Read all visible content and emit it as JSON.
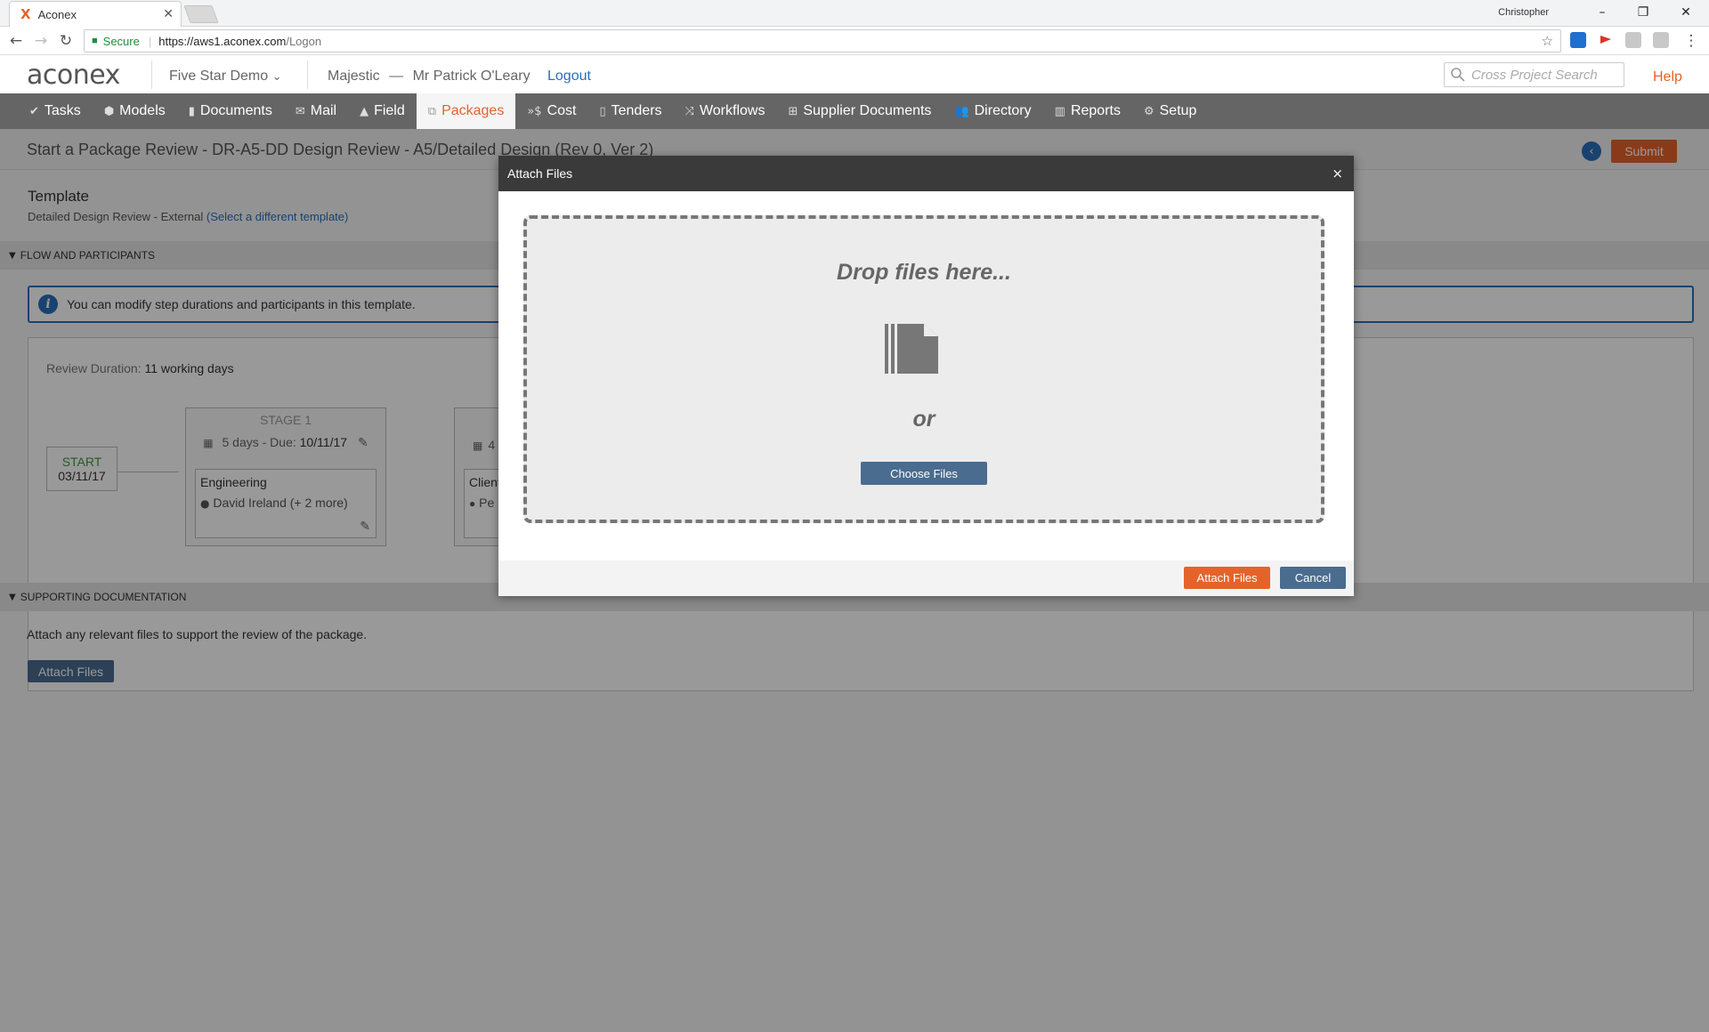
{
  "browser": {
    "tab_title": "Aconex",
    "tab_favicon": "X",
    "user": "Christopher",
    "secure_label": "Secure",
    "url_main": "https://aws1.aconex.com",
    "url_path": "/Logon"
  },
  "header": {
    "logo": "aconex",
    "project": "Five Star Demo",
    "org": "Majestic",
    "dash": "—",
    "user": "Mr Patrick O'Leary",
    "logout": "Logout",
    "search_placeholder": "Cross Project Search",
    "help": "Help"
  },
  "nav": [
    {
      "label": "Tasks",
      "icon": "check-icon"
    },
    {
      "label": "Models",
      "icon": "cube-icon"
    },
    {
      "label": "Documents",
      "icon": "document-icon"
    },
    {
      "label": "Mail",
      "icon": "mail-icon"
    },
    {
      "label": "Field",
      "icon": "field-icon"
    },
    {
      "label": "Packages",
      "icon": "packages-icon",
      "active": true
    },
    {
      "label": "Cost",
      "icon": "cost-icon"
    },
    {
      "label": "Tenders",
      "icon": "tenders-icon"
    },
    {
      "label": "Workflows",
      "icon": "workflows-icon"
    },
    {
      "label": "Supplier Documents",
      "icon": "supplier-icon"
    },
    {
      "label": "Directory",
      "icon": "directory-icon"
    },
    {
      "label": "Reports",
      "icon": "reports-icon"
    },
    {
      "label": "Setup",
      "icon": "gear-icon"
    }
  ],
  "page": {
    "title": "Start a Package Review - DR-A5-DD Design Review - A5/Detailed Design (Rev 0, Ver 2)",
    "submit": "Submit",
    "template_heading": "Template",
    "template_value": "Detailed Design Review - External",
    "template_link": "(Select a different template)",
    "flow_section": "FLOW AND PARTICIPANTS",
    "info_text": "You can modify step durations and participants in this template.",
    "duration_label": "Review Duration:",
    "duration_value": "11 working days",
    "start_label": "START",
    "start_date": "03/11/17",
    "stage1": {
      "title": "STAGE 1",
      "days": "5 days - Due:",
      "due": "10/11/17",
      "group": "Engineering",
      "members": "David Ireland (+ 2 more)"
    },
    "stage2": {
      "days": "4",
      "group": "Client",
      "members": "Pe"
    },
    "supporting_section": "SUPPORTING DOCUMENTATION",
    "supporting_text": "Attach any relevant files to support the review of the package.",
    "attach_button": "Attach Files"
  },
  "modal": {
    "title": "Attach Files",
    "close": "×",
    "drop_text": "Drop files here...",
    "or_text": "or",
    "choose_button": "Choose Files",
    "attach_button": "Attach Files",
    "cancel_button": "Cancel"
  },
  "colors": {
    "accent": "#e5632a",
    "link": "#2a6ebb",
    "nav_bg": "#656565",
    "button_blue": "#4a6c8f"
  }
}
